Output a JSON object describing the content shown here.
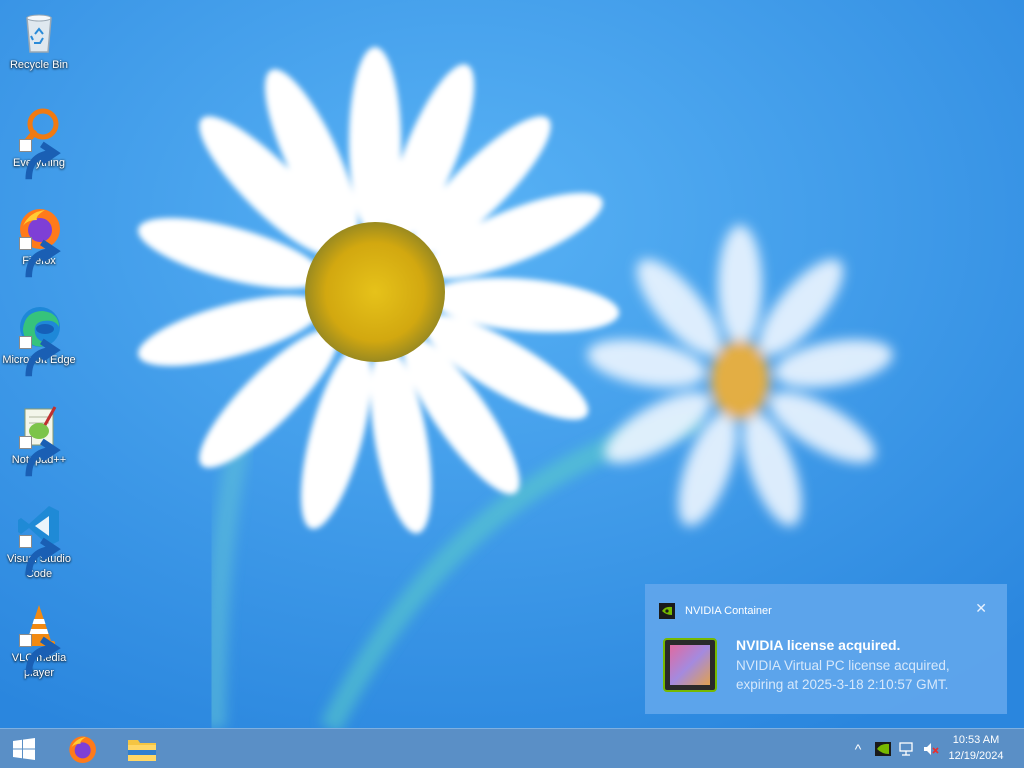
{
  "desktop": {
    "icons": [
      {
        "label": "Recycle Bin"
      },
      {
        "label": "Everything"
      },
      {
        "label": "Firefox"
      },
      {
        "label": "Microsoft Edge"
      },
      {
        "label": "Notepad++"
      },
      {
        "label": "Visual Studio Code"
      },
      {
        "label": "VLC media player"
      }
    ]
  },
  "notification": {
    "app_name": "NVIDIA Container",
    "title": "NVIDIA license acquired.",
    "message": "NVIDIA Virtual PC license acquired, expiring at 2025-3-18 2:10:57 GMT.",
    "close_glyph": "✕"
  },
  "taskbar": {
    "start_icon": "windows-logo-icon",
    "pinned": [
      {
        "icon": "firefox-icon"
      },
      {
        "icon": "file-explorer-icon"
      }
    ],
    "tray": {
      "chevron_glyph": "^",
      "icons": [
        "nvidia-icon",
        "network-icon",
        "volume-muted-icon"
      ]
    },
    "clock": {
      "time": "10:53 AM",
      "date": "12/19/2024"
    }
  },
  "colors": {
    "taskbar": "#5a8fc6",
    "toast": "#60a6ec",
    "nvidia_green": "#76b900"
  }
}
